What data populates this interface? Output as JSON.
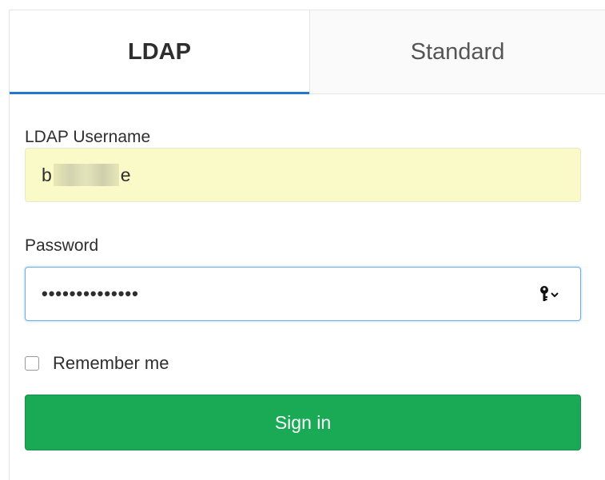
{
  "tabs": [
    {
      "label": "LDAP",
      "active": true
    },
    {
      "label": "Standard",
      "active": false
    }
  ],
  "form": {
    "username_label": "LDAP Username",
    "username_prefix": "b",
    "username_suffix": "e",
    "password_label": "Password",
    "password_value": "••••••••••••••",
    "remember_label": "Remember me",
    "remember_checked": false,
    "submit_label": "Sign in"
  },
  "icons": {
    "password_manager": "key-icon"
  },
  "colors": {
    "tab_active_underline": "#1f78d1",
    "autofill_background": "#fafac8",
    "focus_border": "#66afe9",
    "submit_background": "#1aaa55"
  }
}
